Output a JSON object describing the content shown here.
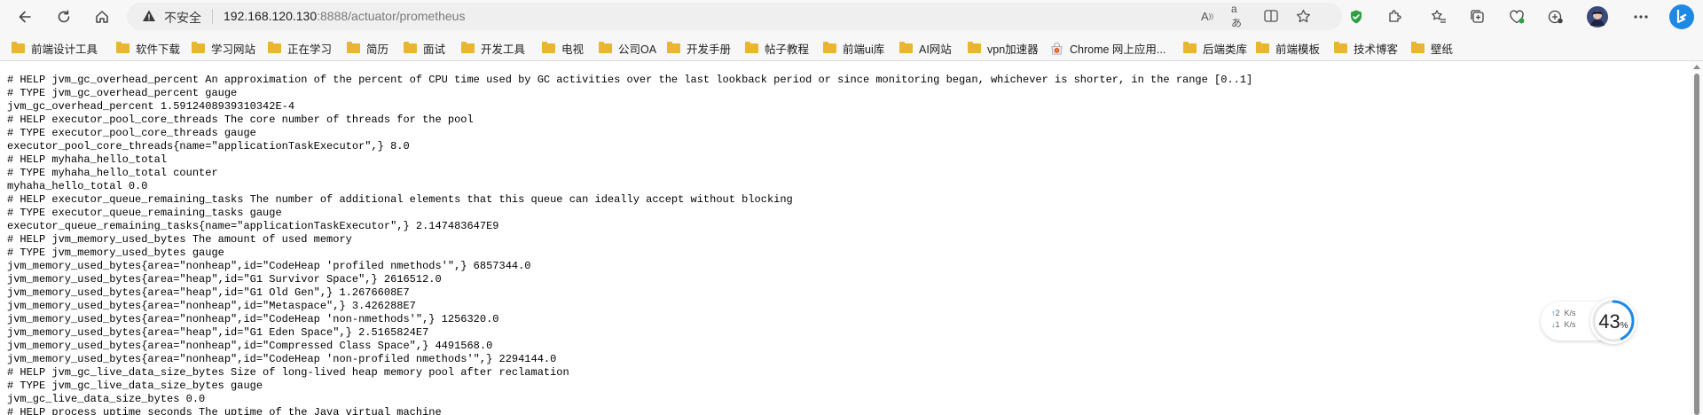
{
  "address_bar": {
    "security_label": "不安全",
    "url_host": "192.168.120.130",
    "url_rest": ":8888/actuator/prometheus"
  },
  "bookmarks": [
    "前端设计工具",
    "软件下载",
    "学习网站",
    "正在学习",
    "简历",
    "面试",
    "开发工具",
    "电视",
    "公司OA",
    "开发手册",
    "帖子教程",
    "前端ui库",
    "AI网站",
    "vpn加速器",
    "Chrome 网上应用...",
    "后端类库",
    "前端模板",
    "技术博客",
    "壁纸"
  ],
  "metrics_lines": [
    "# HELP jvm_gc_overhead_percent An approximation of the percent of CPU time used by GC activities over the last lookback period or since monitoring began, whichever is shorter, in the range [0..1]",
    "# TYPE jvm_gc_overhead_percent gauge",
    "jvm_gc_overhead_percent 1.5912408939310342E-4",
    "# HELP executor_pool_core_threads The core number of threads for the pool",
    "# TYPE executor_pool_core_threads gauge",
    "executor_pool_core_threads{name=\"applicationTaskExecutor\",} 8.0",
    "# HELP myhaha_hello_total",
    "# TYPE myhaha_hello_total counter",
    "myhaha_hello_total 0.0",
    "# HELP executor_queue_remaining_tasks The number of additional elements that this queue can ideally accept without blocking",
    "# TYPE executor_queue_remaining_tasks gauge",
    "executor_queue_remaining_tasks{name=\"applicationTaskExecutor\",} 2.147483647E9",
    "# HELP jvm_memory_used_bytes The amount of used memory",
    "# TYPE jvm_memory_used_bytes gauge",
    "jvm_memory_used_bytes{area=\"nonheap\",id=\"CodeHeap 'profiled nmethods'\",} 6857344.0",
    "jvm_memory_used_bytes{area=\"heap\",id=\"G1 Survivor Space\",} 2616512.0",
    "jvm_memory_used_bytes{area=\"heap\",id=\"G1 Old Gen\",} 1.2676608E7",
    "jvm_memory_used_bytes{area=\"nonheap\",id=\"Metaspace\",} 3.426288E7",
    "jvm_memory_used_bytes{area=\"nonheap\",id=\"CodeHeap 'non-nmethods'\",} 1256320.0",
    "jvm_memory_used_bytes{area=\"heap\",id=\"G1 Eden Space\",} 2.5165824E7",
    "jvm_memory_used_bytes{area=\"nonheap\",id=\"Compressed Class Space\",} 4491568.0",
    "jvm_memory_used_bytes{area=\"nonheap\",id=\"CodeHeap 'non-profiled nmethods'\",} 2294144.0",
    "# HELP jvm_gc_live_data_size_bytes Size of long-lived heap memory pool after reclamation",
    "# TYPE jvm_gc_live_data_size_bytes gauge",
    "jvm_gc_live_data_size_bytes 0.0",
    "# HELP process_uptime_seconds The uptime of the Java virtual machine"
  ],
  "net_widget": {
    "upload_rate": "2",
    "download_rate": "1",
    "unit": "K/s",
    "usage_percent": 43,
    "usage_value": "43",
    "usage_unit": "%"
  },
  "colors": {
    "folder": "#e8b62f",
    "shield_green": "#2ea043",
    "gauge_blue": "#1e88e5"
  }
}
